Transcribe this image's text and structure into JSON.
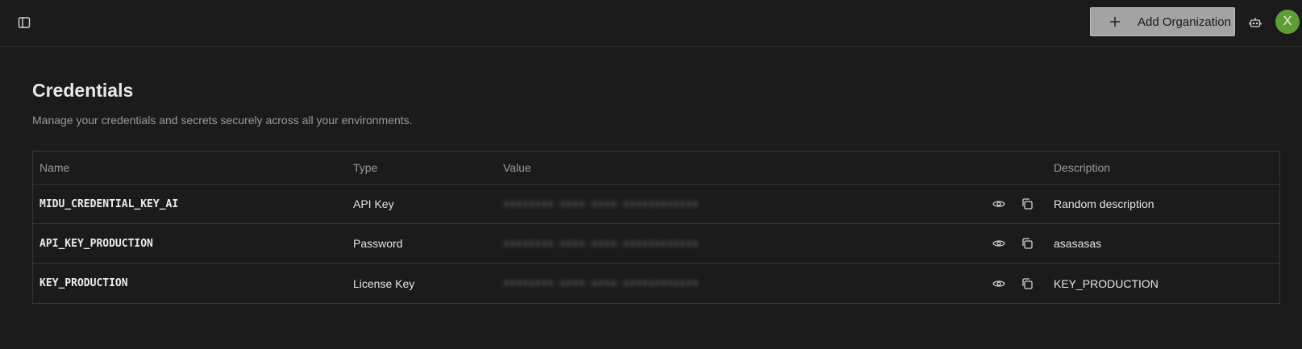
{
  "header": {
    "add_org_label": "Add Organization",
    "avatar_initial": "X",
    "icons": {
      "sidebar": "sidebar-toggle-icon",
      "plus": "plus-icon",
      "robot": "robot-icon"
    }
  },
  "page": {
    "title": "Credentials",
    "subtitle": "Manage your credentials and secrets securely across all your environments."
  },
  "table": {
    "columns": {
      "name": "Name",
      "type": "Type",
      "value": "Value",
      "description": "Description"
    },
    "rows": [
      {
        "name": "MIDU_CREDENTIAL_KEY_AI",
        "type": "API Key",
        "value": "xxxxxxxx-xxxx-xxxx-xxxxxxxxxxxx",
        "description": "Random description"
      },
      {
        "name": "API_KEY_PRODUCTION",
        "type": "Password",
        "value": "xxxxxxxx-xxxx-xxxx-xxxxxxxxxxxx",
        "description": "asasasas"
      },
      {
        "name": "KEY_PRODUCTION",
        "type": "License Key",
        "value": "xxxxxxxx-xxxx-xxxx-xxxxxxxxxxxx",
        "description": "KEY_PRODUCTION"
      }
    ]
  },
  "colors": {
    "background": "#1b1b1b",
    "button_bg": "#a3a3a3",
    "avatar_bg": "#5f9e36",
    "border": "#353535"
  }
}
